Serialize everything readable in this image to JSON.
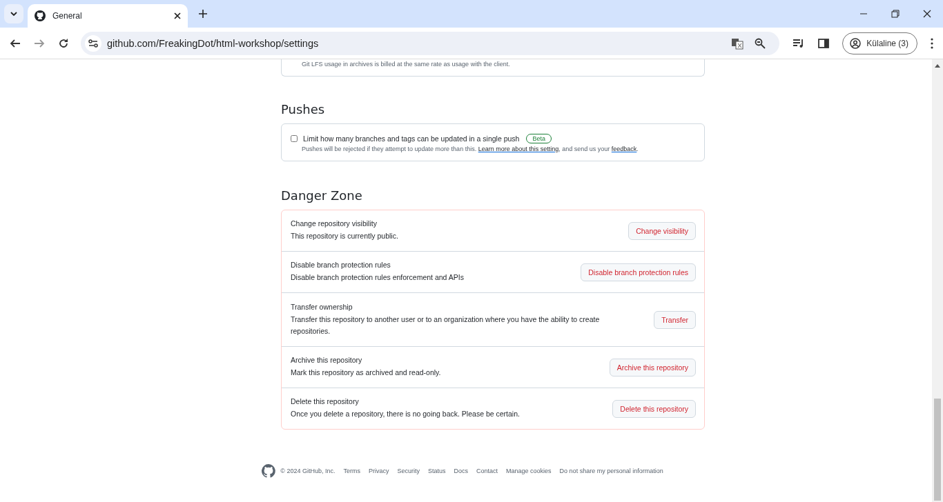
{
  "browser": {
    "tabs": [
      {
        "title": "General",
        "selected": true
      }
    ],
    "url": "github.com/FreakingDot/html-workshop/settings",
    "profile": "Külaline (3)"
  },
  "lfs_note": "Git LFS usage in archives is billed at the same rate as usage with the client.",
  "pushes": {
    "heading": "Pushes",
    "option": {
      "label": "Limit how many branches and tags can be updated in a single push",
      "checked": false,
      "badge": "Beta",
      "text_before": "Pushes will be rejected if they attempt to update more than this.",
      "link_1": "Learn more about this setting",
      "text_middle": ", and send us your",
      "link_2": "feedback",
      "text_after": "."
    }
  },
  "danger_zone": {
    "heading": "Danger Zone",
    "items": [
      {
        "title": "Change repository visibility",
        "description": "This repository is currently public.",
        "button": "Change visibility"
      },
      {
        "title": "Disable branch protection rules",
        "description": "Disable branch protection rules enforcement and APIs",
        "button": "Disable branch protection rules"
      },
      {
        "title": "Transfer ownership",
        "description": "Transfer this repository to another user or to an organization where you have the ability to create repositories.",
        "button": "Transfer"
      },
      {
        "title": "Archive this repository",
        "description": "Mark this repository as archived and read-only.",
        "button": "Archive this repository"
      },
      {
        "title": "Delete this repository",
        "description": "Once you delete a repository, there is no going back. Please be certain.",
        "button": "Delete this repository"
      }
    ]
  },
  "footer": {
    "copyright": "© 2024 GitHub, Inc.",
    "links": [
      "Terms",
      "Privacy",
      "Security",
      "Status",
      "Docs",
      "Contact",
      "Manage cookies",
      "Do not share my personal information"
    ]
  }
}
